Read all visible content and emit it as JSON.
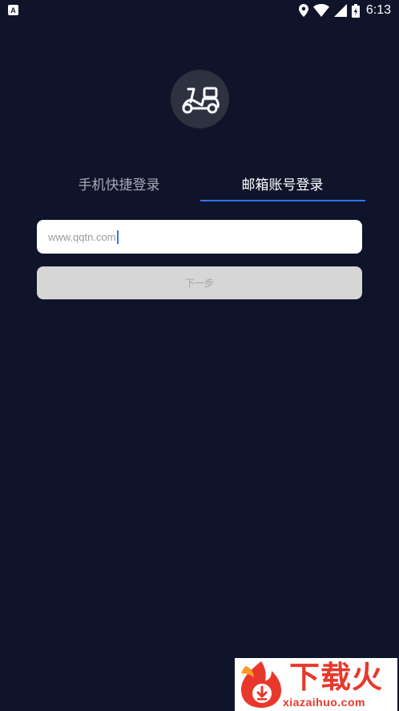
{
  "status_bar": {
    "notification_icon": "a-notification-icon",
    "time": "6:13"
  },
  "tabs": [
    {
      "label": "手机快捷登录",
      "active": false
    },
    {
      "label": "邮箱账号登录",
      "active": true
    }
  ],
  "email_input": {
    "value": "www.qqtn.com"
  },
  "next_button": {
    "label": "下一步"
  },
  "watermark": {
    "text": "下载火",
    "url": "xiazaihuo.com"
  },
  "colors": {
    "background": "#10142a",
    "accent": "#2f73ff",
    "logo_circle": "#2d3140",
    "button_disabled": "#d6d6d6",
    "watermark_red": "#e8382b"
  }
}
